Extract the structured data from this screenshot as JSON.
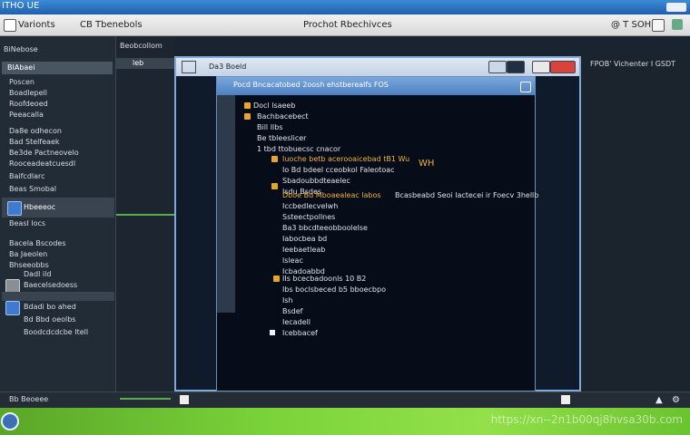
{
  "titlebar": {
    "left_text": "ITHO UE"
  },
  "menubar": {
    "left": "Varionts",
    "mid": "CB Tbenebols",
    "center": "Prochot Rbechivces",
    "right": "@ T SOH"
  },
  "left_panel": {
    "header": "BiNebose",
    "selected": "BIAbaei",
    "items": [
      "Poscen",
      "Boadlepell",
      "Roofdeoed",
      "Peeacalla",
      "Da8e odhecon",
      "Bad Stelfeaek",
      "Be3de Pactneovelo",
      "Rooceadeatcuesdl",
      "Baifcdlarc",
      "Beas Smobal"
    ],
    "section_label": "Hbeeeoc",
    "section2": "BeasI locs",
    "items2": [
      "Bacela Bscodes",
      "Ba Jaeolen",
      "Bhseeobbs",
      "Dadl ild",
      "Baecelsedoess",
      "Bdadi bo ahed",
      "Bd Bbd oeolbs",
      "Boodcdcdcbe Itell"
    ]
  },
  "center": {
    "label": "Beobcollom",
    "cell": "leb"
  },
  "outer_window": {
    "title": "Da3 Boeld"
  },
  "right_panel": {
    "text": "FPOB' Vichenter I GSDT"
  },
  "inner_window": {
    "title": "Pocd Bncacatobed 2oosh ehstberealfs FOS",
    "tree": [
      "Docl lsaeeb",
      "Bachbacebect",
      "Bill Ilbs",
      "Be tbleeslicer",
      "1 tbd ttobuecsc cnacor",
      "Iuoche betb acerooaicebad tB1 Wu",
      "Io Bd bdeel cceobkol Faleotoac",
      "Sbadoubbdteaelec",
      "Isdu Bsdes",
      "Dboe Bd Mboaealeac labos",
      "Iccbedlecvelwh",
      "Ssteectpollnes",
      "Ba3 bbcdteeobboolelse",
      "Iabocbea bd",
      "Ieebaetleab",
      "lsleac",
      "Icbadoabbd",
      "IIs bcecbadoonls 10 B2",
      "Ibs boclsbeced b5 bboecbpo",
      "Ish",
      "Bsdef",
      "Iecadell",
      "Icebbacef"
    ],
    "notes": [
      "WH",
      "Bcasbeabd Seoi lactecei ir Foecv 3hellb"
    ]
  },
  "status": {
    "left": "Bb Beoeee"
  },
  "taskbar": {
    "url": "https://xn--2n1b00qj8hvsa30b.com"
  },
  "colors": {
    "accent": "#3c8bd6",
    "tree_highlight": "#f0b23a",
    "taskbar": "#7bd43a"
  }
}
